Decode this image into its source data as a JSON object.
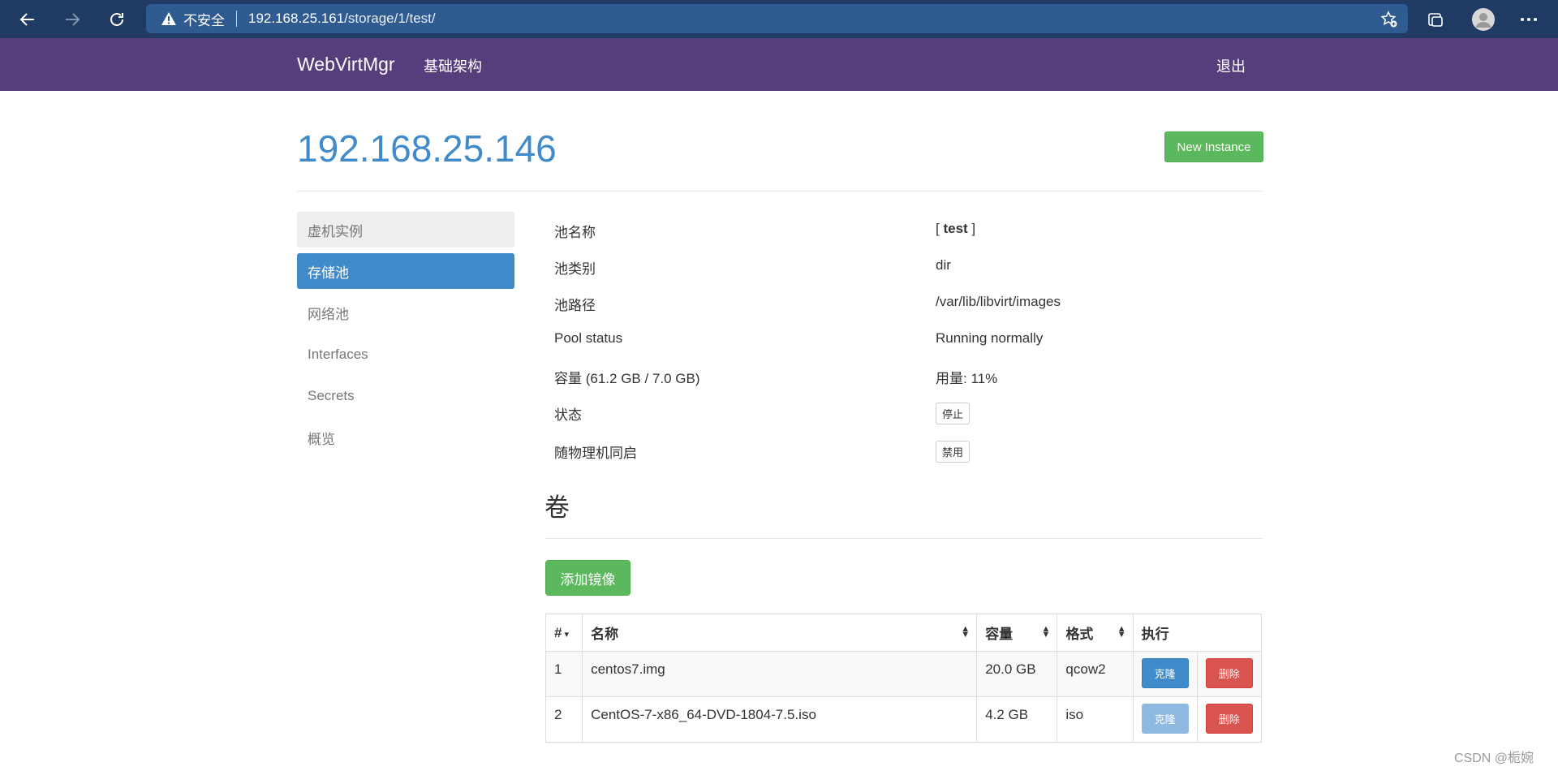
{
  "browser": {
    "insecure_label": "不安全",
    "url_host": "192.168.25.161",
    "url_path": "/storage/1/test/"
  },
  "navbar": {
    "brand": "WebVirtMgr",
    "infra": "基础架构",
    "logout": "退出"
  },
  "header": {
    "title": "192.168.25.146",
    "new_instance": "New Instance"
  },
  "sidebar": {
    "items": [
      {
        "label": "虚机实例"
      },
      {
        "label": "存储池"
      },
      {
        "label": "网络池"
      },
      {
        "label": "Interfaces"
      },
      {
        "label": "Secrets"
      },
      {
        "label": "概览"
      }
    ]
  },
  "pool_info": {
    "name_label": "池名称",
    "name_open": "[ ",
    "name_value": "test",
    "name_close": " ]",
    "type_label": "池类别",
    "type_value": "dir",
    "path_label": "池路径",
    "path_value": "/var/lib/libvirt/images",
    "status_label": "Pool status",
    "status_value": "Running normally",
    "capacity_label": "容量 (61.2 GB / 7.0 GB)",
    "usage_value": "用量: 11%",
    "state_label": "状态",
    "stop_button": "停止",
    "autostart_label": "随物理机同启",
    "disable_button": "禁用"
  },
  "volumes": {
    "title": "卷",
    "add_button": "添加镜像",
    "headers": {
      "num": "#",
      "name": "名称",
      "size": "容量",
      "format": "格式",
      "action": "执行"
    },
    "rows": [
      {
        "num": "1",
        "name": "centos7.img",
        "size": "20.0 GB",
        "format": "qcow2",
        "clone": "克隆",
        "delete": "删除"
      },
      {
        "num": "2",
        "name": "CentOS-7-x86_64-DVD-1804-7.5.iso",
        "size": "4.2 GB",
        "format": "iso",
        "clone": "克隆",
        "delete": "删除"
      }
    ]
  },
  "watermark": "CSDN @栀婉",
  "colors": {
    "navbar": "#563d7c",
    "primary": "#428bca",
    "success": "#5cb85c",
    "danger": "#d9534f"
  }
}
